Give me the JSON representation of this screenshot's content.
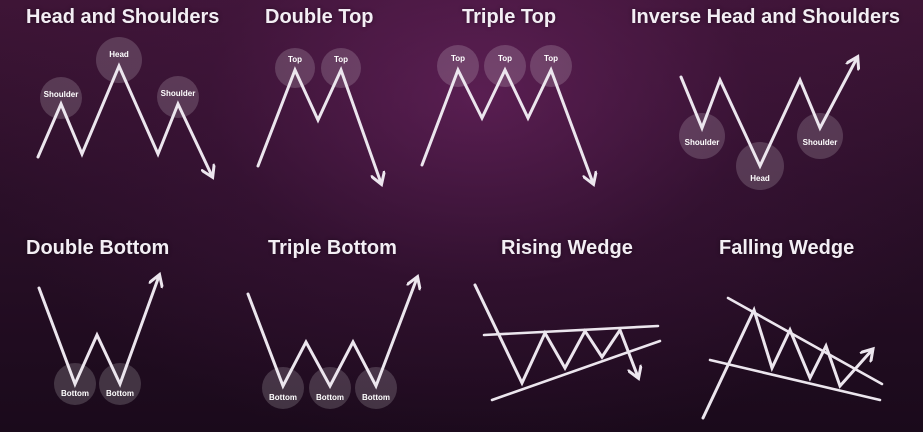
{
  "patterns": [
    {
      "title": "Head and Shoulders",
      "labels": [
        "Shoulder",
        "Head",
        "Shoulder"
      ]
    },
    {
      "title": "Double Top",
      "labels": [
        "Top",
        "Top"
      ]
    },
    {
      "title": "Triple Top",
      "labels": [
        "Top",
        "Top",
        "Top"
      ]
    },
    {
      "title": "Inverse Head and Shoulders",
      "labels": [
        "Shoulder",
        "Head",
        "Shoulder"
      ]
    },
    {
      "title": "Double Bottom",
      "labels": [
        "Bottom",
        "Bottom"
      ]
    },
    {
      "title": "Triple Bottom",
      "labels": [
        "Bottom",
        "Bottom",
        "Bottom"
      ]
    },
    {
      "title": "Rising Wedge",
      "labels": []
    },
    {
      "title": "Falling Wedge",
      "labels": []
    }
  ],
  "colors": {
    "background": "#2a0f28",
    "line": "#ece6ee",
    "text": "#f3eef4"
  }
}
